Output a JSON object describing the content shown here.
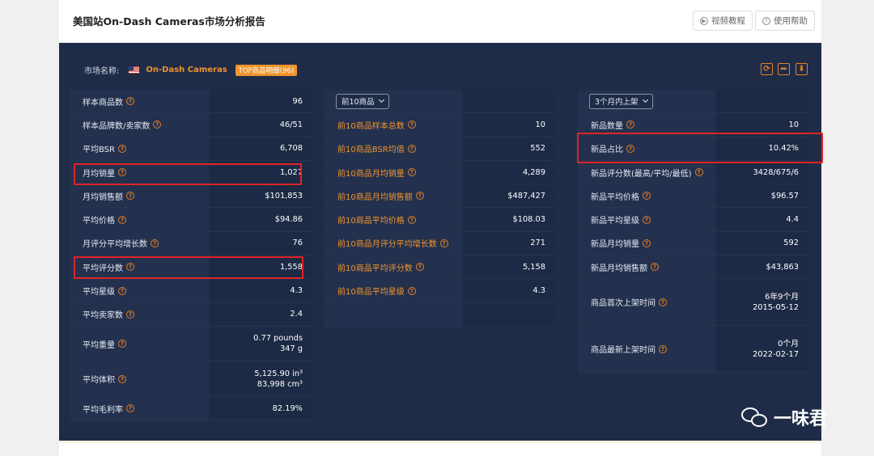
{
  "header": {
    "title": "美国站On-Dash Cameras市场分析报告",
    "video_btn": "视频教程",
    "help_btn": "使用帮助"
  },
  "market": {
    "label": "市场名称:",
    "name": "On-Dash Cameras",
    "badge": "TOP商品明细(96)"
  },
  "col1": [
    {
      "label": "样本商品数",
      "value": "96"
    },
    {
      "label": "样本品牌数/卖家数",
      "value": "46/51"
    },
    {
      "label": "平均BSR",
      "value": "6,708"
    },
    {
      "label": "月均销量",
      "value": "1,027"
    },
    {
      "label": "月均销售额",
      "value": "$101,853"
    },
    {
      "label": "平均价格",
      "value": "$94.86"
    },
    {
      "label": "月评分平均增长数",
      "value": "76"
    },
    {
      "label": "平均评分数",
      "value": "1,558"
    },
    {
      "label": "平均星级",
      "value": "4.3"
    },
    {
      "label": "平均卖家数",
      "value": "2.4"
    },
    {
      "label": "平均重量",
      "value": "0.77 pounds",
      "value2": "347 g"
    },
    {
      "label": "平均体积",
      "value": "5,125.90 in³",
      "value2": "83,998 cm³"
    },
    {
      "label": "平均毛利率",
      "value": "82.19%"
    }
  ],
  "col2": {
    "select": "前10商品",
    "rows": [
      {
        "label": "前10商品样本总数",
        "value": "10"
      },
      {
        "label": "前10商品BSR均值",
        "value": "552"
      },
      {
        "label": "前10商品月均销量",
        "value": "4,289"
      },
      {
        "label": "前10商品月均销售额",
        "value": "$487,427"
      },
      {
        "label": "前10商品平均价格",
        "value": "$108.03"
      },
      {
        "label": "前10商品月评分平均增长数",
        "value": "271"
      },
      {
        "label": "前10商品平均评分数",
        "value": "5,158"
      },
      {
        "label": "前10商品平均星级",
        "value": "4.3"
      }
    ]
  },
  "col3": {
    "select": "3个月内上架",
    "rows": [
      {
        "label": "新品数量",
        "value": "10"
      },
      {
        "label": "新品占比",
        "value": "10.42%"
      },
      {
        "label": "新品评分数(最高/平均/最低)",
        "value": "3428/675/6"
      },
      {
        "label": "新品平均价格",
        "value": "$96.57"
      },
      {
        "label": "新品平均星级",
        "value": "4.4"
      },
      {
        "label": "新品月均销量",
        "value": "592"
      },
      {
        "label": "新品月均销售额",
        "value": "$43,863"
      },
      {
        "label": "商品首次上架时间",
        "value": "6年9个月",
        "value2": "2015-05-12"
      },
      {
        "label": "商品最新上架时间",
        "value": "0个月",
        "value2": "2022-02-17"
      }
    ]
  },
  "watermark": "一味君",
  "colors": {
    "panel_bg": "#1f2c48",
    "accent": "#f0932b",
    "highlight": "#e02424"
  }
}
